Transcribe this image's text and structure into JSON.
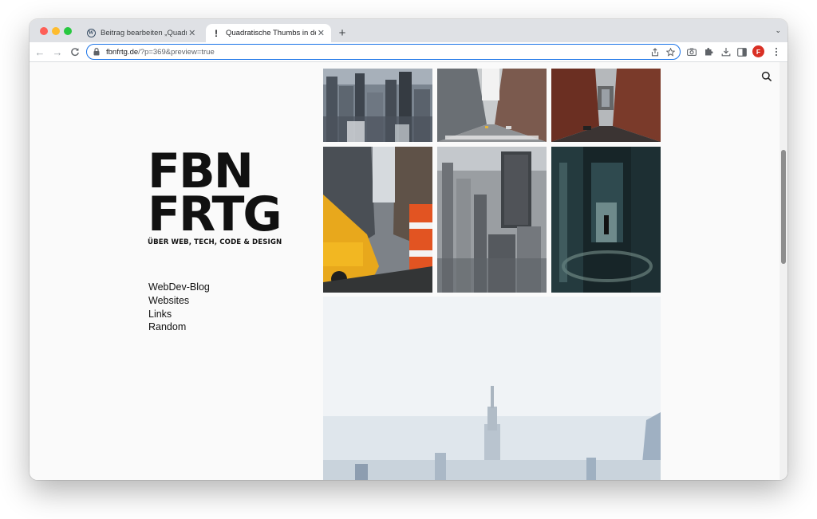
{
  "browser": {
    "tabs": [
      {
        "title": "Beitrag bearbeiten „Quadratische Thumbs in der WordPress-Galerie“",
        "icon": "wordpress-icon",
        "active": false
      },
      {
        "title": "Quadratische Thumbs in der WordPress-Galerie",
        "icon": "exclamation-icon",
        "active": true
      }
    ],
    "new_tab_symbol": "+",
    "url_host": "fbnfrtg.de",
    "url_path": "/?p=369&preview=true",
    "profile_initial": "F",
    "accent_color": "#1a73e8",
    "profile_color": "#d93025"
  },
  "site": {
    "logo_line1": "FBN",
    "logo_line2": "FRTG",
    "tagline": "ÜBER WEB, TECH, CODE & DESIGN",
    "menu": [
      "WebDev-Blog",
      "Websites",
      "Links",
      "Random"
    ]
  },
  "gallery": {
    "images": [
      "city-skyline-thumb",
      "city-street-crosswalk-thumb",
      "manhattan-bridge-street-thumb",
      "yellow-taxi-thumb",
      "aerial-skyscrapers-thumb",
      "subway-station-thumb",
      "empire-state-skyline-large"
    ]
  }
}
